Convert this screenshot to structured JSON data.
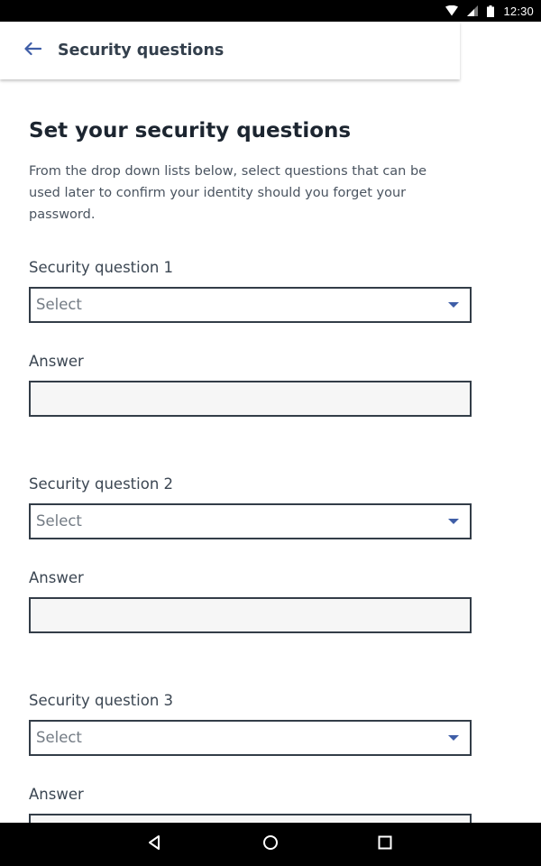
{
  "status_bar": {
    "time": "12:30",
    "icons": [
      "wifi-icon",
      "cell-signal-icon",
      "battery-icon"
    ]
  },
  "app_bar": {
    "back_icon": "arrow-left-icon",
    "title": "Security questions"
  },
  "content": {
    "heading": "Set your security questions",
    "description": "From the drop down lists below, select questions that can be used later to confirm your identity should you forget your password.",
    "questions": [
      {
        "label": "Security question 1",
        "selected": "Select",
        "answer_label": "Answer",
        "answer_value": ""
      },
      {
        "label": "Security question 2",
        "selected": "Select",
        "answer_label": "Answer",
        "answer_value": ""
      },
      {
        "label": "Security question 3",
        "selected": "Select",
        "answer_label": "Answer",
        "answer_value": ""
      }
    ]
  },
  "nav_bar": {
    "buttons": [
      "back-triangle-icon",
      "home-circle-icon",
      "recents-square-icon"
    ]
  },
  "colors": {
    "accent": "#3f5ea7",
    "field_border": "#333d48",
    "answer_fill": "#f6f6f6",
    "system_bars": "#000000"
  }
}
